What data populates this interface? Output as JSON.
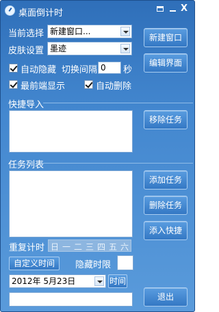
{
  "window": {
    "title": "桌面倒计时",
    "icons": {
      "app": "clock-icon",
      "menu": "menu-icon",
      "minimize": "minimize-icon",
      "close": "close-icon"
    },
    "close_glyph": "X"
  },
  "selection": {
    "label": "当前选择",
    "value": "新建窗口..."
  },
  "skin": {
    "label": "皮肤设置",
    "value": "墨迹"
  },
  "options": {
    "auto_hide": {
      "label": "自动隐藏",
      "checked": true
    },
    "switch_interval": {
      "label": "切换间隔",
      "value": "0",
      "unit": "秒"
    },
    "always_on_top": {
      "label": "最前端显示",
      "checked": true
    },
    "auto_delete": {
      "label": "自动删除",
      "checked": true
    }
  },
  "buttons": {
    "new_window": "新建窗口",
    "edit_ui": "编辑界面",
    "remove_task": "移除任务",
    "add_task": "添加任务",
    "delete_task": "删除任务",
    "add_shortcut": "添入快捷",
    "custom_time": "自定义时间",
    "time": "时间",
    "exit": "退出"
  },
  "sections": {
    "quick_import": "快捷导入",
    "task_list": "任务列表"
  },
  "repeat": {
    "label": "重复计时",
    "days": [
      "日",
      "一",
      "二",
      "三",
      "四",
      "五",
      "六"
    ]
  },
  "hide_limit": {
    "label": "隐藏时限",
    "value": ""
  },
  "date_picker": {
    "value": "2012年  5月23日"
  },
  "bottom_input": {
    "value": ""
  },
  "colors": {
    "title_bg": "#2f6fb9",
    "button_bg": "#3478c4",
    "accent_text": "#ffffff"
  }
}
